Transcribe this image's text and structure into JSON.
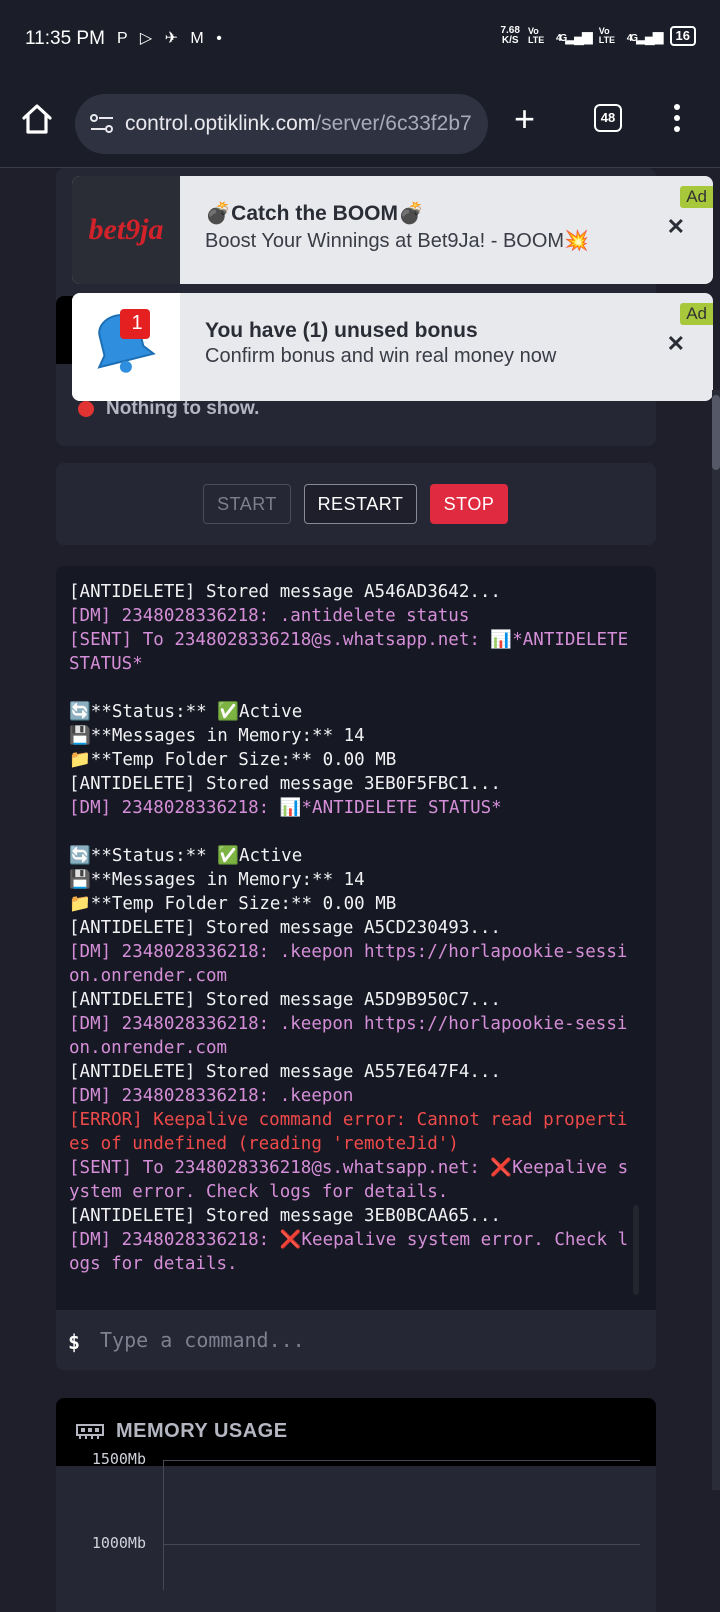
{
  "status_bar": {
    "time": "11:35 PM",
    "left_icons": "P ▷ ✈ M •",
    "net_speed_value": "7.68",
    "net_speed_unit": "K/S",
    "vo_lte_1": "Vo LTE",
    "net_4g_1": "4G",
    "vo_lte_2": "Vo LTE",
    "net_4g_2": "4G",
    "battery": "16"
  },
  "browser": {
    "url_host": "control.optiklink.com",
    "url_path": "/server/6c33f2b7",
    "tab_count": "48"
  },
  "background_panel": {
    "nothing_text": "Nothing to show."
  },
  "ads": [
    {
      "logo_text_main": "bet",
      "logo_text_accent": "9ja",
      "title": "💣Catch the BOOM💣",
      "subtitle": "Boost Your Winnings at Bet9Ja! - BOOM💥",
      "badge": "Ad",
      "close": "✕"
    },
    {
      "notification_count": "1",
      "title": "You have (1) unused bonus",
      "subtitle": "Confirm bonus and win real money now",
      "badge": "Ad",
      "close": "✕"
    }
  ],
  "controls": {
    "start_label": "START",
    "restart_label": "RESTART",
    "stop_label": "STOP"
  },
  "console": {
    "lines": [
      {
        "type": "white",
        "text": "[ANTIDELETE] Stored message A546AD3642..."
      },
      {
        "type": "pink",
        "text": "[DM] 2348028336218: .antidelete status"
      },
      {
        "type": "pink",
        "text": "[SENT] To 2348028336218@s.whatsapp.net: 📊*ANTIDELETE STATUS*"
      },
      {
        "type": "white",
        "text": ""
      },
      {
        "type": "white",
        "text": "🔄**Status:** ✅Active"
      },
      {
        "type": "white",
        "text": "💾**Messages in Memory:** 14"
      },
      {
        "type": "white",
        "text": "📁**Temp Folder Size:** 0.00 MB"
      },
      {
        "type": "white",
        "text": "[ANTIDELETE] Stored message 3EB0F5FBC1..."
      },
      {
        "type": "pink",
        "text": "[DM] 2348028336218: 📊*ANTIDELETE STATUS*"
      },
      {
        "type": "white",
        "text": ""
      },
      {
        "type": "white",
        "text": "🔄**Status:** ✅Active"
      },
      {
        "type": "white",
        "text": "💾**Messages in Memory:** 14"
      },
      {
        "type": "white",
        "text": "📁**Temp Folder Size:** 0.00 MB"
      },
      {
        "type": "white",
        "text": "[ANTIDELETE] Stored message A5CD230493..."
      },
      {
        "type": "pink",
        "text": "[DM] 2348028336218: .keepon https://horlapookie-session.onrender.com"
      },
      {
        "type": "white",
        "text": "[ANTIDELETE] Stored message A5D9B950C7..."
      },
      {
        "type": "pink",
        "text": "[DM] 2348028336218: .keepon https://horlapookie-session.onrender.com"
      },
      {
        "type": "white",
        "text": "[ANTIDELETE] Stored message A557E647F4..."
      },
      {
        "type": "pink",
        "text": "[DM] 2348028336218: .keepon"
      },
      {
        "type": "red",
        "text": "[ERROR] Keepalive command error: Cannot read properties of undefined (reading 'remoteJid')"
      },
      {
        "type": "pink",
        "text": "[SENT] To 2348028336218@s.whatsapp.net: ❌Keepalive system error. Check logs for details."
      },
      {
        "type": "white",
        "text": "[ANTIDELETE] Stored message 3EB0BCAA65..."
      },
      {
        "type": "pink",
        "text": "[DM] 2348028336218: ❌Keepalive system error. Check logs for details."
      }
    ],
    "prompt": "$",
    "input_placeholder": "Type a command..."
  },
  "memory_panel": {
    "title": "MEMORY USAGE",
    "y_ticks": [
      "1500Mb",
      "1000Mb"
    ]
  }
}
